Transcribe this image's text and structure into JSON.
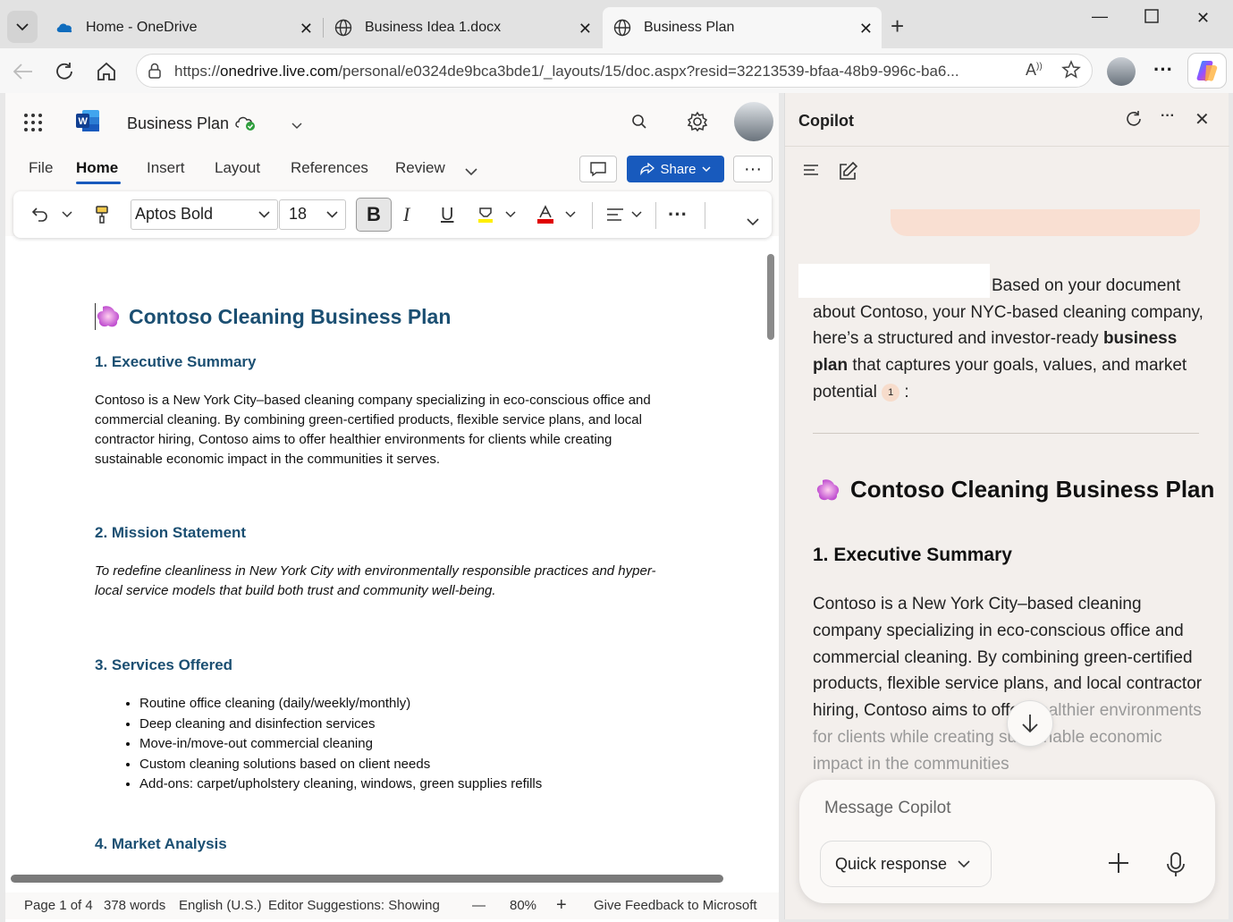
{
  "browser": {
    "tabs": [
      {
        "title": "Home - OneDrive"
      },
      {
        "title": "Business Idea 1.docx"
      },
      {
        "title": "Business Plan"
      }
    ],
    "url_prefix": "https://",
    "url_host": "onedrive.live.com",
    "url_path": "/personal/e0324de9bca3bde1/_layouts/15/doc.aspx?resid=32213539-bfaa-48b9-996c-ba6..."
  },
  "word": {
    "doc_title": "Business Plan",
    "ribbon_tabs": [
      "File",
      "Home",
      "Insert",
      "Layout",
      "References",
      "Review"
    ],
    "share_label": "Share",
    "font_name": "Aptos Bold",
    "font_size": "18",
    "bold_label": "B",
    "italic_label": "I",
    "underline_label": "U",
    "document": {
      "title": "Contoso Cleaning Business Plan",
      "h1": "1. Executive Summary",
      "p1": "Contoso is a New York City–based cleaning company specializing in eco-conscious office and commercial cleaning. By combining green-certified products, flexible service plans, and local contractor hiring, Contoso aims to offer healthier environments for clients while creating sustainable economic impact in the communities it serves.",
      "h2": "2. Mission Statement",
      "p2": "To redefine cleanliness in New York City with environmentally responsible practices and hyper-local service models that build both trust and community well-being.",
      "h3": "3. Services Offered",
      "services": [
        "Routine office cleaning (daily/weekly/monthly)",
        "Deep cleaning and disinfection services",
        "Move-in/move-out commercial cleaning",
        "Custom cleaning solutions based on client needs",
        "Add-ons: carpet/upholstery cleaning, windows, green supplies refills"
      ],
      "h4": "4. Market Analysis"
    },
    "status": {
      "page": "Page 1 of 4",
      "words": "378 words",
      "language": "English (U.S.)",
      "editor": "Editor Suggestions: Showing",
      "minus": "—",
      "zoom": "80%",
      "plus": "+",
      "feedback": "Give Feedback to Microsoft"
    }
  },
  "copilot": {
    "title": "Copilot",
    "intro_a": "Based on your document about Contoso, your NYC-based cleaning company, here’s a structured and investor-ready ",
    "intro_bold": "business plan",
    "intro_b": " that captures your goals, values, and market potential ",
    "cite": "1",
    "intro_end": ":",
    "heading": "Contoso Cleaning Business Plan",
    "subheading": "1. Executive Summary",
    "body": "Contoso is a New York City–based cleaning company specializing in eco-conscious office and commercial cleaning. By combining green-certified products, flexible service plans, and local contractor hiring, Contoso aims to offer",
    "body_faded": "healthier environments for clients while creating sustainable economic impact in the communities",
    "message_placeholder": "Message Copilot",
    "quick_response": "Quick response"
  }
}
